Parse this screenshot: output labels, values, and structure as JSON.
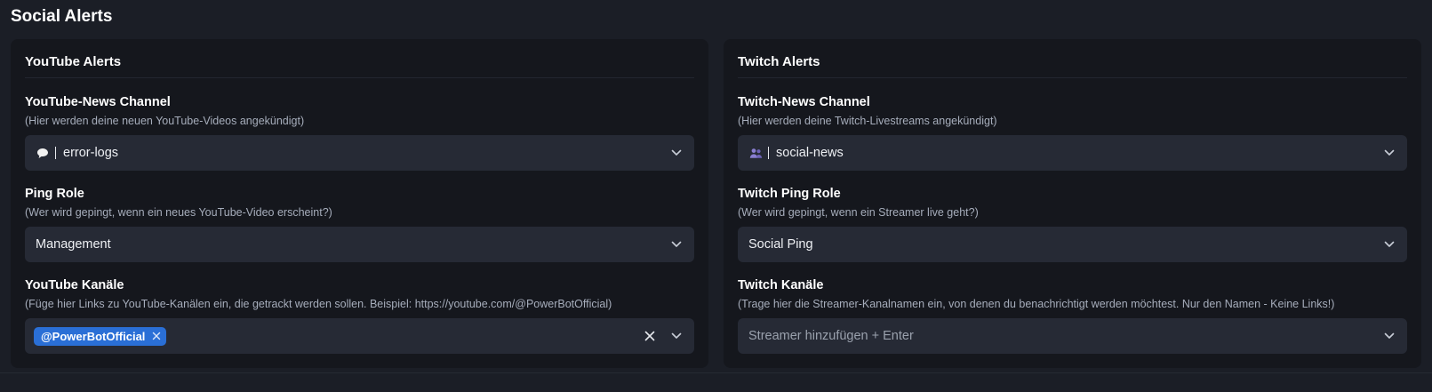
{
  "page": {
    "title": "Social Alerts"
  },
  "youtube": {
    "title": "YouTube Alerts",
    "news_channel": {
      "label": "YouTube-News Channel",
      "help": "(Hier werden deine neuen YouTube-Videos angekündigt)",
      "icon": "speech-bubble-icon",
      "value": "error-logs"
    },
    "ping_role": {
      "label": "Ping Role",
      "help": "(Wer wird gepingt, wenn ein neues YouTube-Video erscheint?)",
      "value": "Management"
    },
    "channels": {
      "label": "YouTube Kanäle",
      "help": "(Füge hier Links zu YouTube-Kanälen ein, die getrackt werden sollen. Beispiel: https://youtube.com/@PowerBotOfficial)",
      "tags": [
        "@PowerBotOfficial"
      ]
    }
  },
  "twitch": {
    "title": "Twitch Alerts",
    "news_channel": {
      "label": "Twitch-News Channel",
      "help": "(Hier werden deine Twitch-Livestreams angekündigt)",
      "icon": "people-icon",
      "value": "social-news"
    },
    "ping_role": {
      "label": "Twitch Ping Role",
      "help": "(Wer wird gepingt, wenn ein Streamer live geht?)",
      "value": "Social Ping"
    },
    "channels": {
      "label": "Twitch Kanäle",
      "help": "(Trage hier die Streamer-Kanalnamen ein, von denen du benachrichtigt werden möchtest. Nur den Namen - Keine Links!)",
      "placeholder": "Streamer hinzufügen + Enter"
    }
  },
  "colors": {
    "background": "#1b1e26",
    "card": "#15171d",
    "input": "#262a35",
    "tag": "#2a6fd6"
  }
}
